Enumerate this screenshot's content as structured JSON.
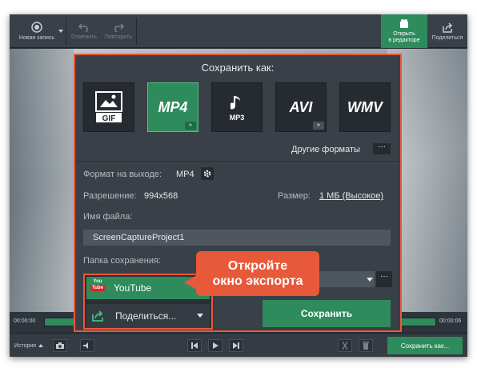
{
  "toolbar": {
    "new_record": "Новая запись",
    "undo": "Отменить",
    "redo": "Повторить",
    "open_editor_1": "Открыть",
    "open_editor_2": "в редакторе",
    "share": "Поделиться"
  },
  "timeline": {
    "start": "00:00:00",
    "end": "00:00:06"
  },
  "bottombar": {
    "history": "История",
    "save_as": "Сохранить как..."
  },
  "dialog": {
    "title": "Сохранить как:",
    "formats": [
      {
        "label": "GIF"
      },
      {
        "label": "MP4"
      },
      {
        "label": "MP3"
      },
      {
        "label": "AVI"
      },
      {
        "label": "WMV"
      }
    ],
    "more_badge": "»",
    "other_formats": "Другие форматы",
    "other_formats_btn": "···",
    "output_format_label": "Формат на выходе:",
    "output_format_value": "MP4",
    "resolution_label": "Разрешение:",
    "resolution_value": "994x568",
    "size_label": "Размер:",
    "size_value": "1 МБ (Высокое)",
    "filename_label": "Имя файла:",
    "filename_value": "ScreenCaptureProject1",
    "folder_label": "Папка сохранения:",
    "folder_btn": "···",
    "youtube": "YouTube",
    "yt_logo_top": "You",
    "yt_logo_bottom": "Tube",
    "share_dropdown": "Поделиться...",
    "save_button": "Сохранить"
  },
  "callout": {
    "line1": "Откройте",
    "line2": "окно экспорта"
  },
  "colors": {
    "accent_green": "#2e8b5c",
    "highlight_orange": "#e8593a"
  }
}
